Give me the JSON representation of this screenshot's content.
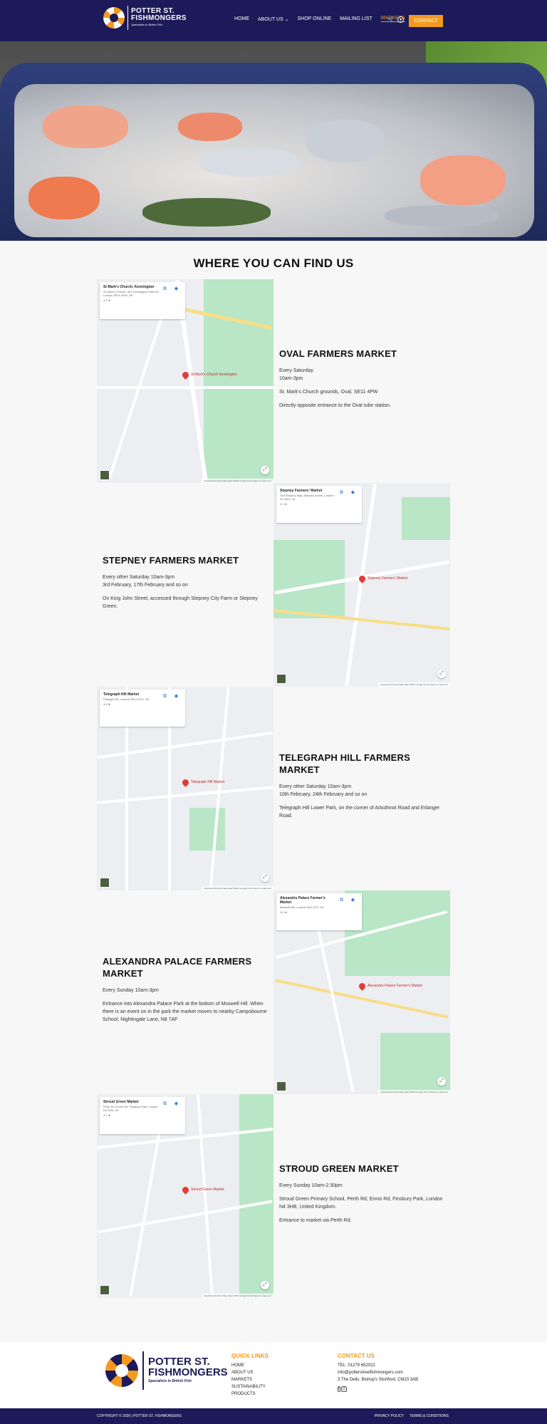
{
  "header": {
    "logo": {
      "line1": "POTTER ST.",
      "line2": "FISHMONGERS",
      "tagline": "Specialists in British Fish"
    },
    "nav": [
      {
        "label": "HOME"
      },
      {
        "label": "ABOUT US ⌄"
      },
      {
        "label": "SHOP ONLINE"
      },
      {
        "label": "MAILING LIST"
      },
      {
        "label": "MARKETS",
        "active": true
      }
    ],
    "icons": [
      "cart-icon",
      "user-icon"
    ],
    "contact_label": "CONTACT"
  },
  "main": {
    "title": "WHERE YOU CAN FIND US",
    "markets": [
      {
        "name": "OVAL FARMERS MARKET",
        "lines": [
          "Every Saturday",
          "10am-3pm"
        ],
        "address": "St. Mark's Church grounds, Oval, SE11 4PW",
        "note": "Directly opposite entrance to the Oval tube station.",
        "map": {
          "card_name": "St Mark's Church, Kennington",
          "card_address": "St. Mark's Church, 337 Kennington Park Rd, London SE11 4PW, UK",
          "rating": "4.2 ★",
          "pin": "St Mark's Church Kennington"
        }
      },
      {
        "name": "STEPNEY FARMERS MARKET",
        "lines": [
          "Every other Saturday 10am-3pm",
          "3rd February, 17th February and so on"
        ],
        "address": "On King John Street, accessed through Stepney City Farm or Stepney Green.",
        "note": "",
        "map": {
          "card_name": "Stepney Farmers' Market",
          "card_address": "229 Stepney Way, Stepney Green, London E1 3DH, UK",
          "rating": "4.1 ★",
          "pin": "Stepney Farmers' Market"
        }
      },
      {
        "name": "TELEGRAPH HILL FARMERS MARKET",
        "lines": [
          "Every other Saturday 10am-3pm",
          "10th February, 24th February and so on"
        ],
        "address": "Telegraph Hill Lower Park, on the corner of Arbuthnot Road and Erlanger Road.",
        "note": "",
        "map": {
          "card_name": "Telegraph Hill Market",
          "card_address": "Erlanger Rd, London SE14 5TH, UK",
          "rating": "4.6 ★",
          "pin": "Telegraph Hill Market"
        }
      },
      {
        "name": "ALEXANDRA PALACE FARMERS MARKET",
        "lines": [
          "Every Sunday 10am-3pm"
        ],
        "address": "Entrance into Alexandra Palace Park at the bottom of Muswell Hill. When there is an event on in the park the market moves to nearby Campsbourne School, Nightingale Lane, N8 7AF",
        "note": "",
        "map": {
          "card_name": "Alexandra Palace Farmer's Market",
          "card_address": "Muswell Hill, London N10 3TG, UK",
          "rating": "4.5 ★",
          "pin": "Alexandra Palace Farmer's Market"
        }
      },
      {
        "name": "STROUD GREEN MARKET",
        "lines": [
          "Every Sunday 10am-2:30pm"
        ],
        "address": "Stroud Green Primary School, Perth Rd, Ennis Rd, Finsbury Park, London N4 3HB, United Kingdom.",
        "note": "Entrance to market via Perth Rd.",
        "map": {
          "card_name": "Stroud Green Market",
          "card_address": "Perth Rd, Ennis Rd, Finsbury Park, London N4 3HB, UK",
          "rating": "4.7 ★",
          "pin": "Stroud Green Market"
        }
      }
    ],
    "map_footer": "Keyboard shortcuts   Map data ©2024 Google   Terms   Report a map error"
  },
  "footer": {
    "logo": {
      "line1": "POTTER ST.",
      "line2": "FISHMONGERS",
      "tagline": "Specialists in British Fish"
    },
    "quick_links_title": "QUICK LINKS",
    "quick_links": [
      "HOME",
      "ABOUT US",
      "MARKETS",
      "SUSTAINABILITY",
      "PRODUCTS"
    ],
    "contact_title": "CONTACT US",
    "contact": [
      "TEL: 01279 652022",
      "info@potterstreetfishmongers.com",
      "3 The Dells, Bishop's Stortford, CM23 3AB"
    ],
    "socials": [
      "facebook-icon",
      "instagram-icon"
    ],
    "copyright": "COPYRIGHT © 2026 | POTTER ST. FISHMONGERS",
    "bottom_links": [
      "PRIVACY POLICY",
      "TERMS & CONDITIONS"
    ]
  },
  "colors": {
    "navy": "#1c1a58",
    "orange": "#f39a1e",
    "background": "#f7f7f7"
  }
}
